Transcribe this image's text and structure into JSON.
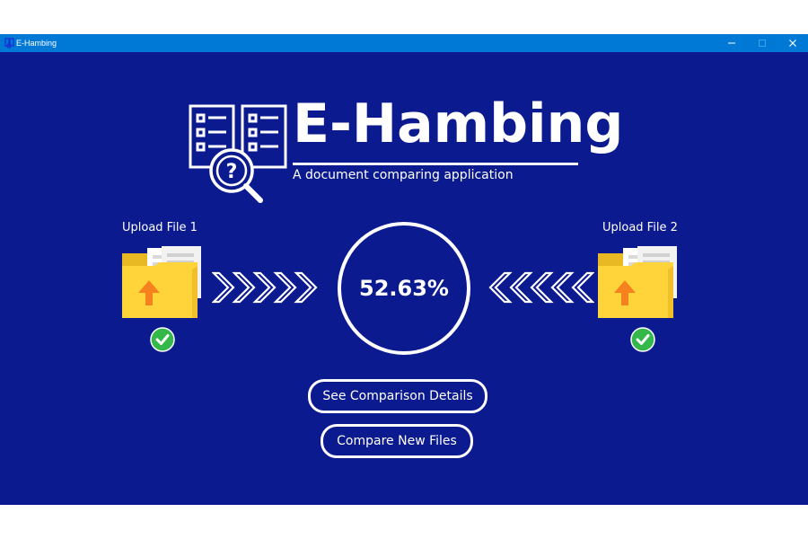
{
  "window": {
    "title": "E-Hambing",
    "colors": {
      "titlebar": "#0079d6",
      "background": "#0c1a8f",
      "folder": "#ffd43b",
      "arrow": "#f5821f",
      "check": "#34b84a"
    },
    "controls": {
      "minimize_icon": "minimize-icon",
      "maximize_icon": "maximize-icon",
      "close_icon": "close-icon"
    }
  },
  "logo": {
    "name": "E-Hambing",
    "tagline": "A document comparing application",
    "icon": "document-search-icon"
  },
  "upload1": {
    "label": "Upload File 1",
    "icon": "folder-upload-icon",
    "status_icon": "check-icon"
  },
  "upload2": {
    "label": "Upload File 2",
    "icon": "folder-upload-icon",
    "status_icon": "check-icon"
  },
  "result": {
    "similarity": "52.63%"
  },
  "buttons": {
    "details": "See Comparison Details",
    "compare_new": "Compare New Files"
  }
}
